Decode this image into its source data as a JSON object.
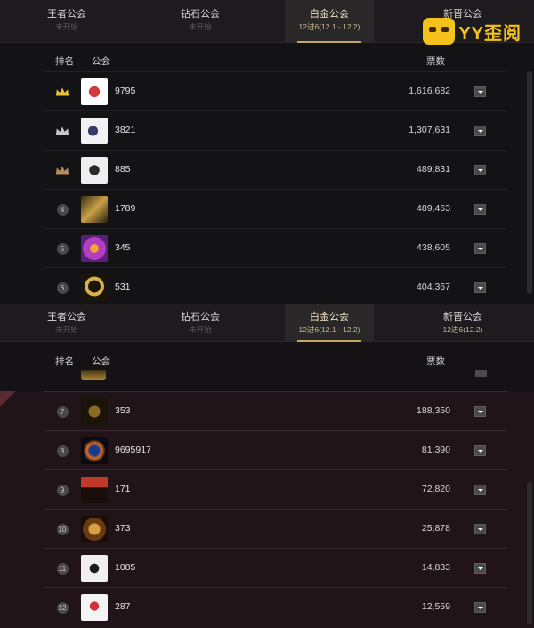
{
  "brand": {
    "text": "YY歪阅",
    "icon": "yy-mascot-icon",
    "color": "#f5c21b"
  },
  "tabs_top": [
    {
      "name": "王者公会",
      "sub": "未开始"
    },
    {
      "name": "钻石公会",
      "sub": "未开始"
    },
    {
      "name": "白金公会",
      "sub": "12进6(12.1 - 12.2)"
    },
    {
      "name": "新晋公会",
      "sub": ""
    }
  ],
  "tabs_bottom": [
    {
      "name": "王者公会",
      "sub": "未开始"
    },
    {
      "name": "钻石公会",
      "sub": "未开始"
    },
    {
      "name": "白金公会",
      "sub": "12进6(12.1 - 12.2)"
    },
    {
      "name": "新晋公会",
      "sub": "12进6(12.2)"
    }
  ],
  "columns": {
    "rank": "排名",
    "guild": "公会",
    "votes": "票数"
  },
  "top_rows": [
    {
      "rank": "",
      "rank_icon": "gold-crown-icon",
      "guild": "9795",
      "votes": "1,616,682"
    },
    {
      "rank": "",
      "rank_icon": "silver-crown-icon",
      "guild": "3821",
      "votes": "1,307,631"
    },
    {
      "rank": "",
      "rank_icon": "bronze-crown-icon",
      "guild": "885",
      "votes": "489,831"
    },
    {
      "rank": "4",
      "guild": "1789",
      "votes": "489,463"
    },
    {
      "rank": "5",
      "guild": "345",
      "votes": "438,605"
    },
    {
      "rank": "6",
      "guild": "531",
      "votes": "404,367"
    }
  ],
  "bottom_rows": [
    {
      "rank": "7",
      "guild": "353",
      "votes": "188,350"
    },
    {
      "rank": "8",
      "guild": "9695917",
      "votes": "81,390"
    },
    {
      "rank": "9",
      "guild": "171",
      "votes": "72,820"
    },
    {
      "rank": "10",
      "guild": "373",
      "votes": "25,878"
    },
    {
      "rank": "11",
      "guild": "1085",
      "votes": "14,833"
    },
    {
      "rank": "12",
      "guild": "287",
      "votes": "12,559"
    }
  ],
  "colors": {
    "accent": "#c8a860",
    "gold": "#e8c433",
    "silver": "#c9c9c9",
    "bronze": "#b98a5a"
  }
}
